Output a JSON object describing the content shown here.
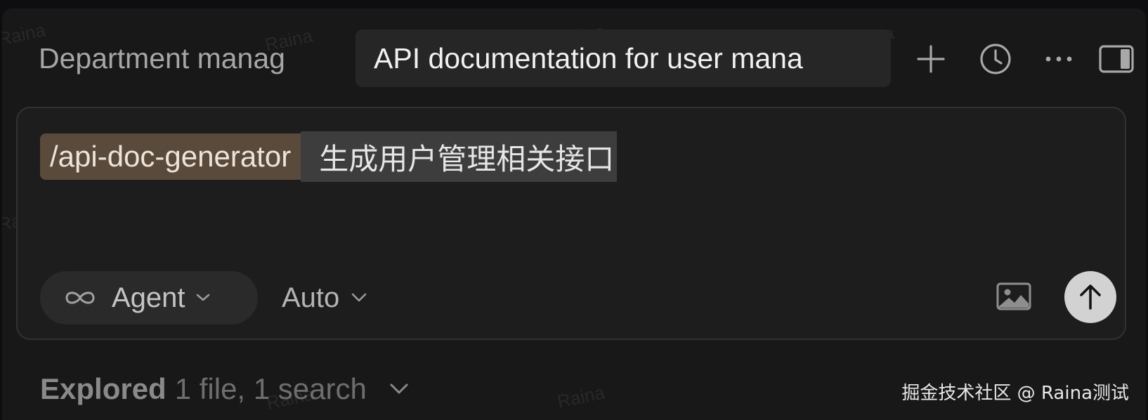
{
  "tabs": [
    {
      "label": "Department manag",
      "active": false
    },
    {
      "label": "API documentation for user mana",
      "active": true
    }
  ],
  "toolbar": {
    "icons": [
      "plus-icon",
      "history-icon",
      "more-icon",
      "panel-toggle-icon"
    ]
  },
  "composer": {
    "command_chip": "/api-doc-generator",
    "prompt_text": "生成用户管理相关接口",
    "mode_label": "Agent",
    "model_label": "Auto",
    "colors": {
      "chip_bg": "#5a4a3c",
      "selection_bg": "#3d3d3d",
      "send_bg": "#d2d2d2"
    }
  },
  "explored": {
    "label": "Explored",
    "summary": "1 file, 1 search"
  },
  "watermark": {
    "text": "Raina",
    "credit": "掘金技术社区 @ Raina测试"
  }
}
